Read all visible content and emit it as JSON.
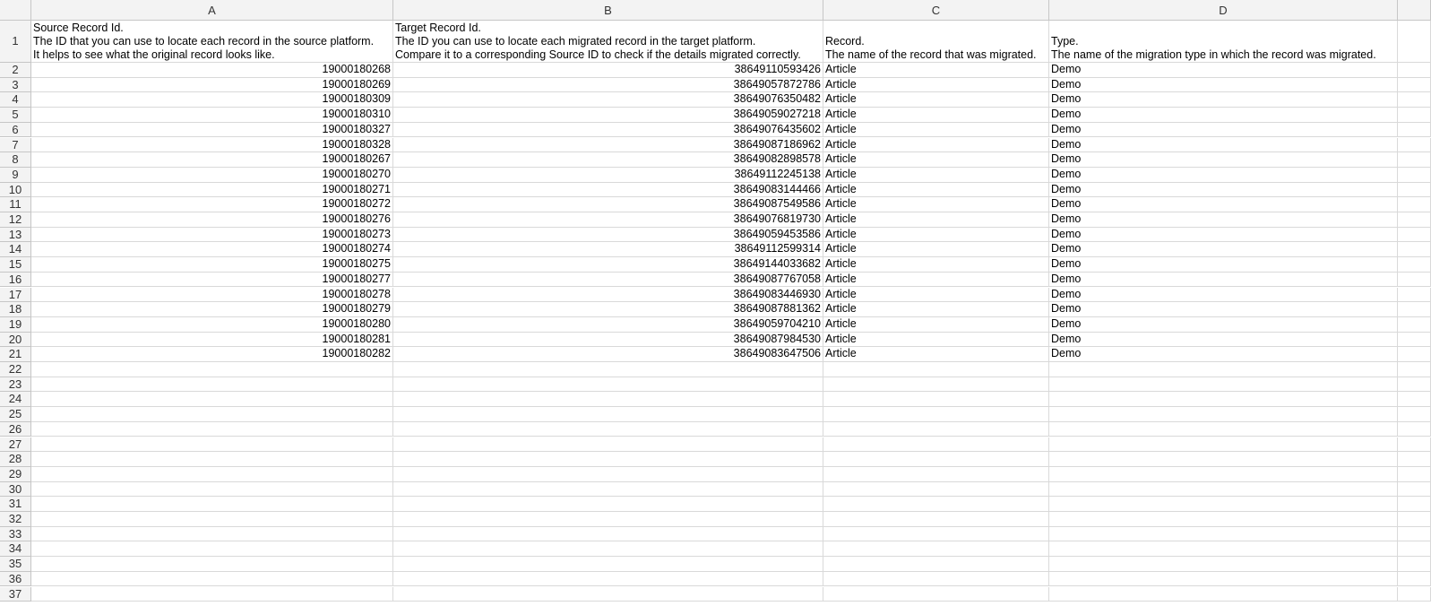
{
  "columns": [
    "A",
    "B",
    "C",
    "D"
  ],
  "header": {
    "a": "Source Record Id.\nThe ID that you can use to locate each record in the source platform.\nIt helps to see what the original record looks like.",
    "b": "Target Record Id.\nThe ID you can use to locate each migrated record in the target platform.\nCompare it to a corresponding Source ID to check if the details migrated correctly.",
    "c": "Record.\nThe name of the record that was migrated.",
    "d": "Type.\n The name of the migration type in which the record was migrated."
  },
  "rows": [
    [
      "19000180268",
      "38649110593426",
      "Article",
      "Demo"
    ],
    [
      "19000180269",
      "38649057872786",
      "Article",
      "Demo"
    ],
    [
      "19000180309",
      "38649076350482",
      "Article",
      "Demo"
    ],
    [
      "19000180310",
      "38649059027218",
      "Article",
      "Demo"
    ],
    [
      "19000180327",
      "38649076435602",
      "Article",
      "Demo"
    ],
    [
      "19000180328",
      "38649087186962",
      "Article",
      "Demo"
    ],
    [
      "19000180267",
      "38649082898578",
      "Article",
      "Demo"
    ],
    [
      "19000180270",
      "38649112245138",
      "Article",
      "Demo"
    ],
    [
      "19000180271",
      "38649083144466",
      "Article",
      "Demo"
    ],
    [
      "19000180272",
      "38649087549586",
      "Article",
      "Demo"
    ],
    [
      "19000180276",
      "38649076819730",
      "Article",
      "Demo"
    ],
    [
      "19000180273",
      "38649059453586",
      "Article",
      "Demo"
    ],
    [
      "19000180274",
      "38649112599314",
      "Article",
      "Demo"
    ],
    [
      "19000180275",
      "38649144033682",
      "Article",
      "Demo"
    ],
    [
      "19000180277",
      "38649087767058",
      "Article",
      "Demo"
    ],
    [
      "19000180278",
      "38649083446930",
      "Article",
      "Demo"
    ],
    [
      "19000180279",
      "38649087881362",
      "Article",
      "Demo"
    ],
    [
      "19000180280",
      "38649059704210",
      "Article",
      "Demo"
    ],
    [
      "19000180281",
      "38649087984530",
      "Article",
      "Demo"
    ],
    [
      "19000180282",
      "38649083647506",
      "Article",
      "Demo"
    ]
  ],
  "row_numbers": [
    "1",
    "2",
    "3",
    "4",
    "5",
    "6",
    "7",
    "8",
    "9",
    "10",
    "11",
    "12",
    "13",
    "14",
    "15",
    "16",
    "17",
    "18",
    "19",
    "20",
    "21",
    "22",
    "23",
    "24",
    "25",
    "26",
    "27",
    "28",
    "29",
    "30",
    "31",
    "32",
    "33",
    "34",
    "35",
    "36",
    "37"
  ]
}
